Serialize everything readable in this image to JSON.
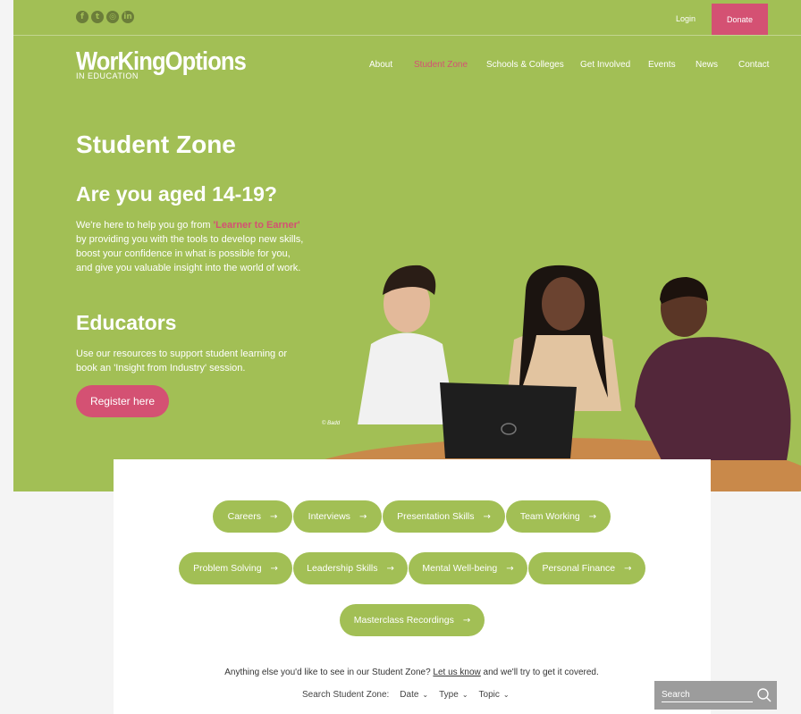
{
  "topbar": {
    "social_icons": [
      "facebook-icon",
      "twitter-icon",
      "instagram-icon",
      "linkedin-icon"
    ],
    "social_glyphs": [
      "f",
      "t",
      "◎",
      "in"
    ],
    "login_label": "Login",
    "donate_label": "Donate"
  },
  "logo": {
    "main": "WorKingOptions",
    "sub": "IN EDUCATION"
  },
  "nav": {
    "items": [
      "About",
      "Student Zone",
      "Schools & Colleges",
      "Get Involved",
      "Events",
      "News",
      "Contact"
    ],
    "active": "Student Zone"
  },
  "hero": {
    "title": "Student Zone",
    "students_heading": "Are you aged 14-19?",
    "students_text_before": "We're here to help you go from ",
    "students_text_highlight": "'Learner to Earner'",
    "students_text_after": " by providing you with the tools to develop new skills, boost your confidence in what is possible for you, and give you valuable insight into the world of work.",
    "educators_heading": "Educators",
    "educators_text": "Use our resources to support student learning or book an 'Insight from Industry' session.",
    "register_label": "Register here",
    "photo_credit": "© Badd"
  },
  "topics": [
    "Careers",
    "Interviews",
    "Presentation Skills",
    "Team Working",
    "Problem Solving",
    "Leadership Skills",
    "Mental Well-being",
    "Personal Finance",
    "Masterclass Recordings"
  ],
  "footer": {
    "note_before": "Anything else you'd like to see in our Student Zone? ",
    "note_link": "Let us know",
    "note_after": " and we'll try to get it covered.",
    "filter_label": "Search Student Zone:",
    "filters": [
      "Date",
      "Type",
      "Topic"
    ],
    "search_placeholder": "Search"
  },
  "colors": {
    "brand_green": "#a2bf55",
    "accent_pink": "#d45173"
  }
}
